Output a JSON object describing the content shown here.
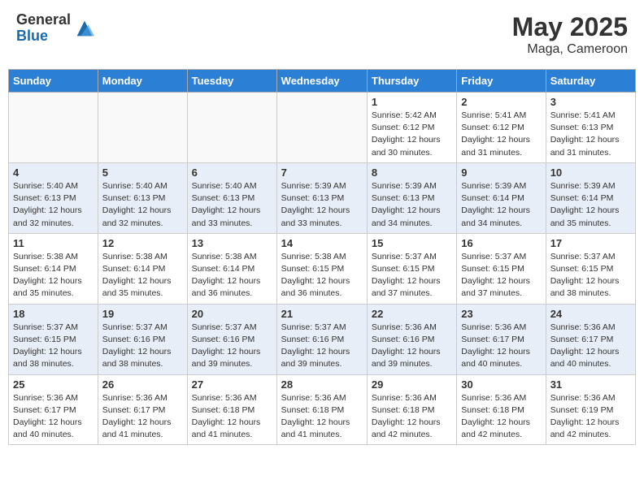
{
  "header": {
    "logo_general": "General",
    "logo_blue": "Blue",
    "month_year": "May 2025",
    "location": "Maga, Cameroon"
  },
  "days_of_week": [
    "Sunday",
    "Monday",
    "Tuesday",
    "Wednesday",
    "Thursday",
    "Friday",
    "Saturday"
  ],
  "weeks": [
    [
      {
        "day": "",
        "info": ""
      },
      {
        "day": "",
        "info": ""
      },
      {
        "day": "",
        "info": ""
      },
      {
        "day": "",
        "info": ""
      },
      {
        "day": "1",
        "info": "Sunrise: 5:42 AM\nSunset: 6:12 PM\nDaylight: 12 hours\nand 30 minutes."
      },
      {
        "day": "2",
        "info": "Sunrise: 5:41 AM\nSunset: 6:12 PM\nDaylight: 12 hours\nand 31 minutes."
      },
      {
        "day": "3",
        "info": "Sunrise: 5:41 AM\nSunset: 6:13 PM\nDaylight: 12 hours\nand 31 minutes."
      }
    ],
    [
      {
        "day": "4",
        "info": "Sunrise: 5:40 AM\nSunset: 6:13 PM\nDaylight: 12 hours\nand 32 minutes."
      },
      {
        "day": "5",
        "info": "Sunrise: 5:40 AM\nSunset: 6:13 PM\nDaylight: 12 hours\nand 32 minutes."
      },
      {
        "day": "6",
        "info": "Sunrise: 5:40 AM\nSunset: 6:13 PM\nDaylight: 12 hours\nand 33 minutes."
      },
      {
        "day": "7",
        "info": "Sunrise: 5:39 AM\nSunset: 6:13 PM\nDaylight: 12 hours\nand 33 minutes."
      },
      {
        "day": "8",
        "info": "Sunrise: 5:39 AM\nSunset: 6:13 PM\nDaylight: 12 hours\nand 34 minutes."
      },
      {
        "day": "9",
        "info": "Sunrise: 5:39 AM\nSunset: 6:14 PM\nDaylight: 12 hours\nand 34 minutes."
      },
      {
        "day": "10",
        "info": "Sunrise: 5:39 AM\nSunset: 6:14 PM\nDaylight: 12 hours\nand 35 minutes."
      }
    ],
    [
      {
        "day": "11",
        "info": "Sunrise: 5:38 AM\nSunset: 6:14 PM\nDaylight: 12 hours\nand 35 minutes."
      },
      {
        "day": "12",
        "info": "Sunrise: 5:38 AM\nSunset: 6:14 PM\nDaylight: 12 hours\nand 35 minutes."
      },
      {
        "day": "13",
        "info": "Sunrise: 5:38 AM\nSunset: 6:14 PM\nDaylight: 12 hours\nand 36 minutes."
      },
      {
        "day": "14",
        "info": "Sunrise: 5:38 AM\nSunset: 6:15 PM\nDaylight: 12 hours\nand 36 minutes."
      },
      {
        "day": "15",
        "info": "Sunrise: 5:37 AM\nSunset: 6:15 PM\nDaylight: 12 hours\nand 37 minutes."
      },
      {
        "day": "16",
        "info": "Sunrise: 5:37 AM\nSunset: 6:15 PM\nDaylight: 12 hours\nand 37 minutes."
      },
      {
        "day": "17",
        "info": "Sunrise: 5:37 AM\nSunset: 6:15 PM\nDaylight: 12 hours\nand 38 minutes."
      }
    ],
    [
      {
        "day": "18",
        "info": "Sunrise: 5:37 AM\nSunset: 6:15 PM\nDaylight: 12 hours\nand 38 minutes."
      },
      {
        "day": "19",
        "info": "Sunrise: 5:37 AM\nSunset: 6:16 PM\nDaylight: 12 hours\nand 38 minutes."
      },
      {
        "day": "20",
        "info": "Sunrise: 5:37 AM\nSunset: 6:16 PM\nDaylight: 12 hours\nand 39 minutes."
      },
      {
        "day": "21",
        "info": "Sunrise: 5:37 AM\nSunset: 6:16 PM\nDaylight: 12 hours\nand 39 minutes."
      },
      {
        "day": "22",
        "info": "Sunrise: 5:36 AM\nSunset: 6:16 PM\nDaylight: 12 hours\nand 39 minutes."
      },
      {
        "day": "23",
        "info": "Sunrise: 5:36 AM\nSunset: 6:17 PM\nDaylight: 12 hours\nand 40 minutes."
      },
      {
        "day": "24",
        "info": "Sunrise: 5:36 AM\nSunset: 6:17 PM\nDaylight: 12 hours\nand 40 minutes."
      }
    ],
    [
      {
        "day": "25",
        "info": "Sunrise: 5:36 AM\nSunset: 6:17 PM\nDaylight: 12 hours\nand 40 minutes."
      },
      {
        "day": "26",
        "info": "Sunrise: 5:36 AM\nSunset: 6:17 PM\nDaylight: 12 hours\nand 41 minutes."
      },
      {
        "day": "27",
        "info": "Sunrise: 5:36 AM\nSunset: 6:18 PM\nDaylight: 12 hours\nand 41 minutes."
      },
      {
        "day": "28",
        "info": "Sunrise: 5:36 AM\nSunset: 6:18 PM\nDaylight: 12 hours\nand 41 minutes."
      },
      {
        "day": "29",
        "info": "Sunrise: 5:36 AM\nSunset: 6:18 PM\nDaylight: 12 hours\nand 42 minutes."
      },
      {
        "day": "30",
        "info": "Sunrise: 5:36 AM\nSunset: 6:18 PM\nDaylight: 12 hours\nand 42 minutes."
      },
      {
        "day": "31",
        "info": "Sunrise: 5:36 AM\nSunset: 6:19 PM\nDaylight: 12 hours\nand 42 minutes."
      }
    ]
  ]
}
